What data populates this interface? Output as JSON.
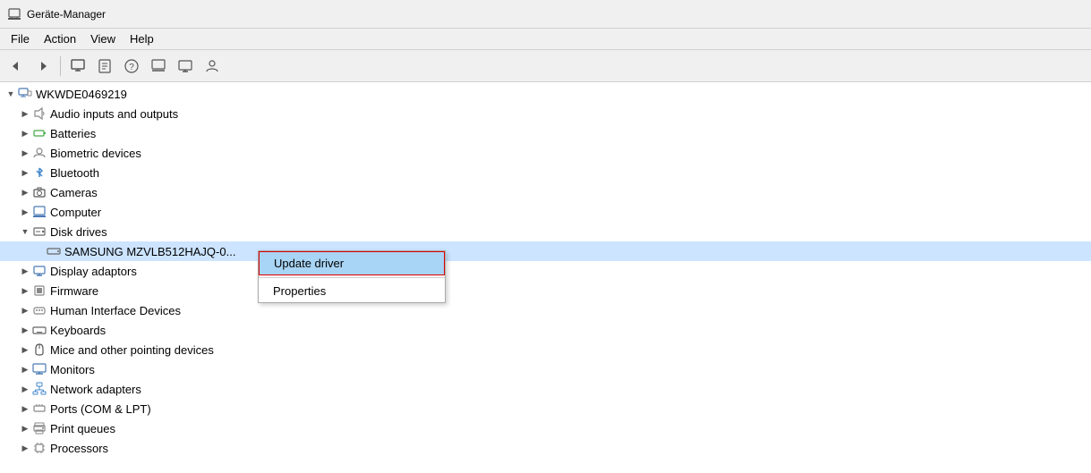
{
  "titlebar": {
    "icon": "⚙",
    "title": "Geräte-Manager"
  },
  "menubar": {
    "items": [
      {
        "label": "File",
        "id": "menu-file"
      },
      {
        "label": "Action",
        "id": "menu-action"
      },
      {
        "label": "View",
        "id": "menu-view"
      },
      {
        "label": "Help",
        "id": "menu-help"
      }
    ]
  },
  "toolbar": {
    "buttons": [
      {
        "icon": "◀",
        "name": "back"
      },
      {
        "icon": "▶",
        "name": "forward"
      },
      {
        "icon": "🖥",
        "name": "computer"
      },
      {
        "icon": "📄",
        "name": "properties"
      },
      {
        "icon": "❓",
        "name": "help"
      },
      {
        "icon": "⊞",
        "name": "grid"
      },
      {
        "icon": "🖥",
        "name": "display"
      },
      {
        "icon": "👤",
        "name": "user"
      }
    ]
  },
  "tree": {
    "root": {
      "label": "WKWDE0469219",
      "expanded": true,
      "children": [
        {
          "label": "Audio inputs and outputs",
          "icon": "audio",
          "level": 1,
          "expanded": false
        },
        {
          "label": "Batteries",
          "icon": "battery",
          "level": 1,
          "expanded": false
        },
        {
          "label": "Biometric devices",
          "icon": "biometric",
          "level": 1,
          "expanded": false
        },
        {
          "label": "Bluetooth",
          "icon": "bluetooth",
          "level": 1,
          "expanded": false
        },
        {
          "label": "Cameras",
          "icon": "camera",
          "level": 1,
          "expanded": false
        },
        {
          "label": "Computer",
          "icon": "computer2",
          "level": 1,
          "expanded": false
        },
        {
          "label": "Disk drives",
          "icon": "disk",
          "level": 1,
          "expanded": true
        },
        {
          "label": "SAMSUNG MZVLB512HAJQ-0...",
          "icon": "diskitem",
          "level": 2,
          "selected": true
        },
        {
          "label": "Display adaptors",
          "icon": "display",
          "level": 1,
          "expanded": false
        },
        {
          "label": "Firmware",
          "icon": "firmware",
          "level": 1,
          "expanded": false
        },
        {
          "label": "Human Interface Devices",
          "icon": "hid",
          "level": 1,
          "expanded": false
        },
        {
          "label": "Keyboards",
          "icon": "keyboard",
          "level": 1,
          "expanded": false
        },
        {
          "label": "Mice and other pointing devices",
          "icon": "mice",
          "level": 1,
          "expanded": false
        },
        {
          "label": "Monitors",
          "icon": "monitor",
          "level": 1,
          "expanded": false
        },
        {
          "label": "Network adapters",
          "icon": "network",
          "level": 1,
          "expanded": false
        },
        {
          "label": "Ports (COM & LPT)",
          "icon": "ports",
          "level": 1,
          "expanded": false
        },
        {
          "label": "Print queues",
          "icon": "printqueue",
          "level": 1,
          "expanded": false
        },
        {
          "label": "Processors",
          "icon": "processor",
          "level": 1,
          "expanded": false
        }
      ]
    }
  },
  "context_menu": {
    "items": [
      {
        "label": "Update driver",
        "highlighted": true
      },
      {
        "label": "Properties",
        "highlighted": false
      }
    ]
  }
}
